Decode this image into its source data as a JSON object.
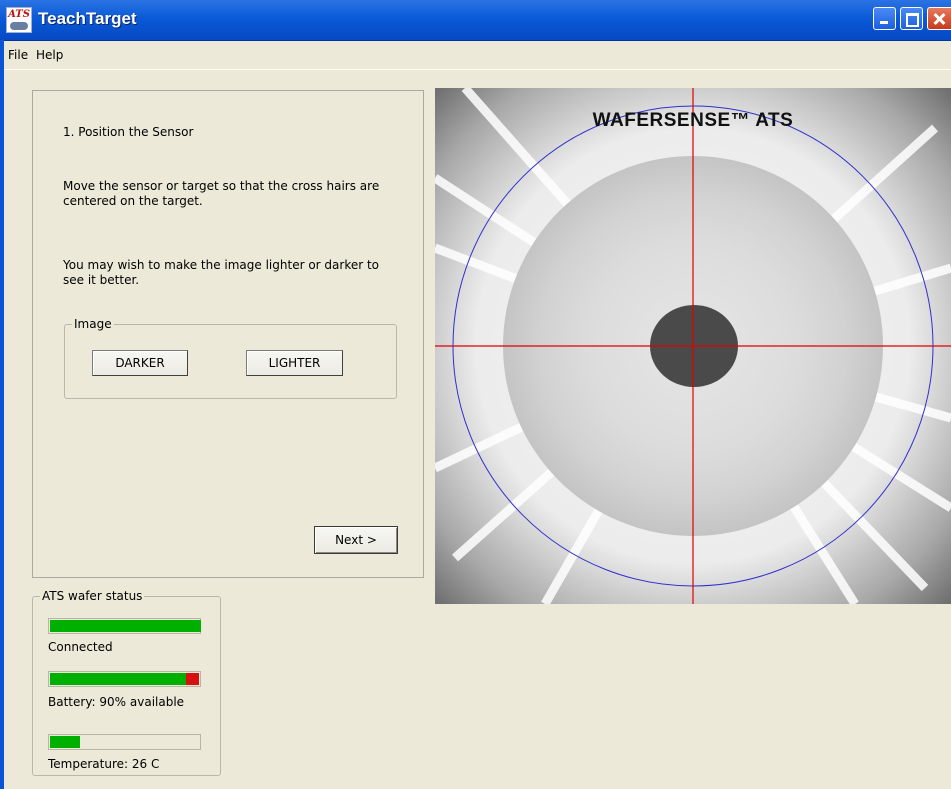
{
  "window": {
    "title": "TeachTarget",
    "icon_text": "ATS"
  },
  "menu": [
    "File",
    "Help"
  ],
  "instructions": {
    "step": "1. Position the Sensor",
    "move": "Move the sensor or target so that the cross hairs are centered on the target.",
    "lighter_darker": "You may wish to make the image lighter or darker to see it better."
  },
  "image_group": {
    "legend": "Image",
    "darker_label": "DARKER",
    "lighter_label": "LIGHTER"
  },
  "next_label": "Next >",
  "camera": {
    "overlay_title": "WAFERSENSE™ ATS",
    "crosshair_color": "#e00000",
    "circle_color": "#2f2fcf"
  },
  "status": {
    "legend": "ATS wafer status",
    "connected_label": "Connected",
    "connected_level": 1.0,
    "battery_label": "Battery: 90% available",
    "battery_level": 0.9,
    "temperature_label": "Temperature: 26 C",
    "temperature_level": 0.2,
    "colors": {
      "ok": "#00b000",
      "remaining": "#d81010"
    }
  }
}
